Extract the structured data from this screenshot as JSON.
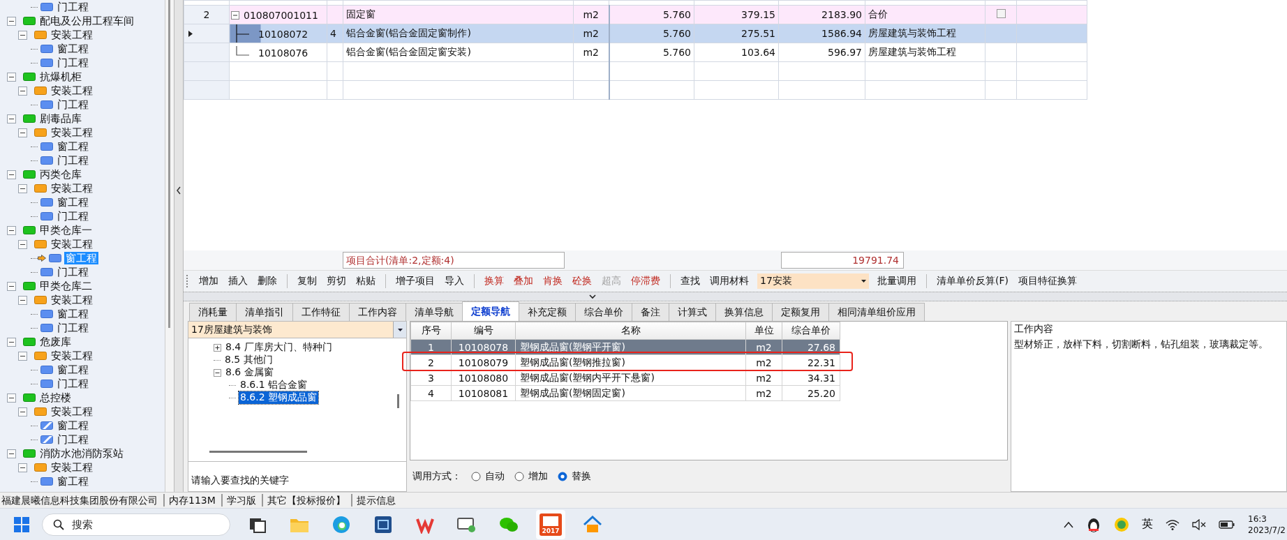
{
  "project_tree": {
    "continued_items": [
      {
        "label": "门工程",
        "kind": "leaf",
        "selected": false
      }
    ],
    "items": [
      {
        "label": "配电及公用工程车间",
        "kind": "unit",
        "expanded": true,
        "children": [
          {
            "label": "安装工程",
            "kind": "section",
            "expanded": true,
            "children": [
              {
                "label": "窗工程",
                "kind": "leaf",
                "selected": false
              },
              {
                "label": "门工程",
                "kind": "leaf",
                "selected": false
              }
            ]
          }
        ]
      },
      {
        "label": "抗爆机柜",
        "kind": "unit",
        "expanded": true,
        "children": [
          {
            "label": "安装工程",
            "kind": "section",
            "expanded": true,
            "children": [
              {
                "label": "门工程",
                "kind": "leaf",
                "selected": false
              }
            ]
          }
        ]
      },
      {
        "label": "剧毒品库",
        "kind": "unit",
        "expanded": true,
        "children": [
          {
            "label": "安装工程",
            "kind": "section",
            "expanded": true,
            "children": [
              {
                "label": "窗工程",
                "kind": "leaf",
                "selected": false
              },
              {
                "label": "门工程",
                "kind": "leaf",
                "selected": false
              }
            ]
          }
        ]
      },
      {
        "label": "丙类仓库",
        "kind": "unit",
        "expanded": true,
        "children": [
          {
            "label": "安装工程",
            "kind": "section",
            "expanded": true,
            "children": [
              {
                "label": "窗工程",
                "kind": "leaf",
                "selected": false
              },
              {
                "label": "门工程",
                "kind": "leaf",
                "selected": false
              }
            ]
          }
        ]
      },
      {
        "label": "甲类仓库一",
        "kind": "unit",
        "expanded": true,
        "children": [
          {
            "label": "安装工程",
            "kind": "section",
            "expanded": true,
            "children": [
              {
                "label": "窗工程",
                "kind": "leaf",
                "selected": true
              },
              {
                "label": "门工程",
                "kind": "leaf",
                "selected": false
              }
            ]
          }
        ]
      },
      {
        "label": "甲类仓库二",
        "kind": "unit",
        "expanded": true,
        "children": [
          {
            "label": "安装工程",
            "kind": "section",
            "expanded": true,
            "children": [
              {
                "label": "窗工程",
                "kind": "leaf",
                "selected": false
              },
              {
                "label": "门工程",
                "kind": "leaf",
                "selected": false
              }
            ]
          }
        ]
      },
      {
        "label": "危废库",
        "kind": "unit",
        "expanded": true,
        "children": [
          {
            "label": "安装工程",
            "kind": "section",
            "expanded": true,
            "children": [
              {
                "label": "窗工程",
                "kind": "leaf",
                "selected": false
              },
              {
                "label": "门工程",
                "kind": "leaf",
                "selected": false
              }
            ]
          }
        ]
      },
      {
        "label": "总控楼",
        "kind": "unit",
        "expanded": true,
        "children": [
          {
            "label": "安装工程",
            "kind": "section",
            "expanded": true,
            "children": [
              {
                "label": "窗工程",
                "kind": "leaf-hatched",
                "selected": false
              },
              {
                "label": "门工程",
                "kind": "leaf-hatched",
                "selected": false
              }
            ]
          }
        ]
      },
      {
        "label": "消防水池消防泵站",
        "kind": "unit",
        "expanded": true,
        "children": [
          {
            "label": "安装工程",
            "kind": "section",
            "expanded": true,
            "children": [
              {
                "label": "窗工程",
                "kind": "leaf",
                "selected": false
              }
            ]
          }
        ]
      }
    ]
  },
  "bill_table": {
    "rows": [
      {
        "kind": "bill",
        "selected": false,
        "column_1": "2",
        "expanded": true,
        "column_2": "010807001011",
        "column_4": "固定窗",
        "column_5": "m2",
        "column_6": "5.760",
        "column_7": "379.15",
        "column_8": "2183.90",
        "column_9": "合价",
        "checked": false
      },
      {
        "kind": "quota",
        "selected": true,
        "column_2": "10108072",
        "column_3": "4",
        "column_4": "铝合金窗(铝合金固定窗制作)",
        "column_5": "m2",
        "column_6": "5.760",
        "column_7": "275.51",
        "column_8": "1586.94",
        "column_9": "房屋建筑与装饰工程"
      },
      {
        "kind": "quota",
        "selected": false,
        "column_2": "10108076",
        "column_4": "铝合金窗(铝合金固定窗安装)",
        "column_5": "m2",
        "column_6": "5.760",
        "column_7": "103.64",
        "column_8": "596.97",
        "column_9": "房屋建筑与装饰工程"
      }
    ]
  },
  "totals": {
    "summary": "项目合计(清单:2,定额:4)",
    "amount": "19791.74"
  },
  "toolbar": {
    "groups": [
      [
        {
          "label": "增加",
          "kind": "plain",
          "disabled": false
        },
        {
          "label": "插入",
          "kind": "plain",
          "disabled": false
        },
        {
          "label": "删除",
          "kind": "plain",
          "disabled": false
        }
      ],
      [
        {
          "label": "复制",
          "kind": "plain",
          "disabled": false
        },
        {
          "label": "剪切",
          "kind": "plain",
          "disabled": false
        },
        {
          "label": "粘贴",
          "kind": "plain",
          "disabled": false
        }
      ],
      [
        {
          "label": "增子项目",
          "kind": "plain",
          "disabled": false
        },
        {
          "label": "导入",
          "kind": "plain",
          "disabled": false
        }
      ],
      [
        {
          "label": "换算",
          "kind": "conversion",
          "disabled": false
        },
        {
          "label": "叠加",
          "kind": "conversion",
          "disabled": false
        },
        {
          "label": "肯换",
          "kind": "conversion",
          "disabled": false
        },
        {
          "label": "砼换",
          "kind": "conversion",
          "disabled": false
        },
        {
          "label": "超高",
          "kind": "conversion",
          "disabled": true
        },
        {
          "label": "停滞费",
          "kind": "conversion",
          "disabled": false
        }
      ],
      [
        {
          "label": "查找",
          "kind": "plain",
          "disabled": false
        },
        {
          "label": "调用材料",
          "kind": "plain",
          "disabled": false
        },
        {
          "label": "17安装",
          "kind": "dropdown",
          "disabled": false
        },
        {
          "label": "批量调用",
          "kind": "plain",
          "disabled": false
        }
      ],
      [
        {
          "label": "清单单价反算(F)",
          "kind": "plain",
          "disabled": false
        },
        {
          "label": "项目特征换算",
          "kind": "plain",
          "disabled": false
        }
      ]
    ]
  },
  "tabs": [
    {
      "label": "消耗量",
      "selected": false
    },
    {
      "label": "清单指引",
      "selected": false
    },
    {
      "label": "工作特征",
      "selected": false
    },
    {
      "label": "工作内容",
      "selected": false
    },
    {
      "label": "清单导航",
      "selected": false
    },
    {
      "label": "定额导航",
      "selected": true
    },
    {
      "label": "补充定额",
      "selected": false
    },
    {
      "label": "综合单价",
      "selected": false
    },
    {
      "label": "备注",
      "selected": false
    },
    {
      "label": "计算式",
      "selected": false
    },
    {
      "label": "换算信息",
      "selected": false
    },
    {
      "label": "定额复用",
      "selected": false
    },
    {
      "label": "相同清单组价应用",
      "selected": false
    }
  ],
  "quota_nav": {
    "library": "17房屋建筑与装饰",
    "tree": [
      {
        "label": "8.4 厂库房大门、特种门",
        "kind": "folder",
        "expanded": false,
        "selected": false
      },
      {
        "label": "8.5 其他门",
        "kind": "leaf",
        "selected": false
      },
      {
        "label": "8.6 金属窗",
        "kind": "folder",
        "expanded": true,
        "selected": false,
        "children": [
          {
            "label": "8.6.1 铝合金窗",
            "kind": "leaf",
            "selected": false
          },
          {
            "label": "8.6.2 塑钢成品窗",
            "kind": "leaf",
            "selected": true
          }
        ]
      }
    ],
    "search": {
      "placeholder": "请输入要查找的关键字"
    }
  },
  "quota_table": {
    "columns": [
      "序号",
      "编号",
      "名称",
      "单位",
      "综合单价"
    ],
    "rows": [
      {
        "number": "1",
        "code": "10108078",
        "name": "塑钢成品窗(塑钢平开窗)",
        "unit": "m2",
        "price": "27.68",
        "selected": true,
        "circled": false
      },
      {
        "number": "2",
        "code": "10108079",
        "name": "塑钢成品窗(塑钢推拉窗)",
        "unit": "m2",
        "price": "22.31",
        "selected": false,
        "circled": true
      },
      {
        "number": "3",
        "code": "10108080",
        "name": "塑钢成品窗(塑钢内平开下悬窗)",
        "unit": "m2",
        "price": "34.31",
        "selected": false,
        "circled": false
      },
      {
        "number": "4",
        "code": "10108081",
        "name": "塑钢成品窗(塑钢固定窗)",
        "unit": "m2",
        "price": "25.20",
        "selected": false,
        "circled": false
      }
    ]
  },
  "call_mode": {
    "label": "调用方式：",
    "options": [
      {
        "label": "自动",
        "selected": false
      },
      {
        "label": "增加",
        "selected": false
      },
      {
        "label": "替换",
        "selected": true
      }
    ]
  },
  "work_content": {
    "title": "工作内容",
    "text": "型材矫正，放样下料，切割断料，钻孔组装，玻璃裁定等。"
  },
  "status_bar": [
    "福建晨曦信息科技集团股份有限公司",
    "内存113M",
    "学习版",
    "其它【投标报价】",
    "提示信息"
  ],
  "taskbar": {
    "search_placeholder": "搜索",
    "apps": [
      {
        "kind": "task-view",
        "active": false
      },
      {
        "kind": "folder",
        "active": false
      },
      {
        "kind": "browser",
        "active": false
      },
      {
        "kind": "cad",
        "active": false
      },
      {
        "kind": "wps",
        "active": false
      },
      {
        "kind": "remote",
        "active": false
      },
      {
        "kind": "chat",
        "active": false
      },
      {
        "kind": "budget",
        "active": true,
        "label": "2017"
      },
      {
        "kind": "house",
        "active": false
      }
    ],
    "input_method": "英",
    "time": "16:3",
    "date": "2023/7/2"
  }
}
